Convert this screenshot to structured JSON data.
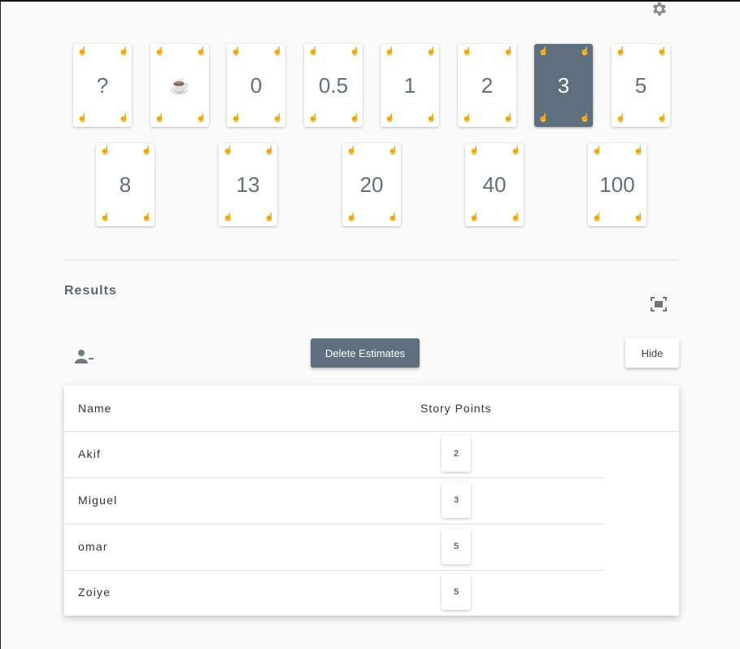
{
  "cards": [
    {
      "label": "?",
      "selected": false
    },
    {
      "label": "☕",
      "selected": false
    },
    {
      "label": "0",
      "selected": false
    },
    {
      "label": "0.5",
      "selected": false
    },
    {
      "label": "1",
      "selected": false
    },
    {
      "label": "2",
      "selected": false
    },
    {
      "label": "3",
      "selected": true
    },
    {
      "label": "5",
      "selected": false
    },
    {
      "label": "8",
      "selected": false
    },
    {
      "label": "13",
      "selected": false
    },
    {
      "label": "20",
      "selected": false
    },
    {
      "label": "40",
      "selected": false
    },
    {
      "label": "100",
      "selected": false
    }
  ],
  "results": {
    "title": "Results",
    "delete_label": "Delete Estimates",
    "hide_label": "Hide"
  },
  "table": {
    "col_name": "Name",
    "col_points": "Story Points",
    "rows": [
      {
        "name": "Akif",
        "points": "2"
      },
      {
        "name": "Miguel",
        "points": "3"
      },
      {
        "name": "omar",
        "points": "5"
      },
      {
        "name": "Zoiye",
        "points": "5"
      }
    ]
  },
  "icons": {
    "settings": "gear-icon",
    "fullscreen": "fullscreen-icon",
    "remove_user": "remove-user-icon",
    "card_corner": "hand-pointer-icon"
  },
  "colors": {
    "accent": "#5f6f7e",
    "card_text": "#5f6f7d",
    "corner_icon": "#7fb8c6"
  }
}
